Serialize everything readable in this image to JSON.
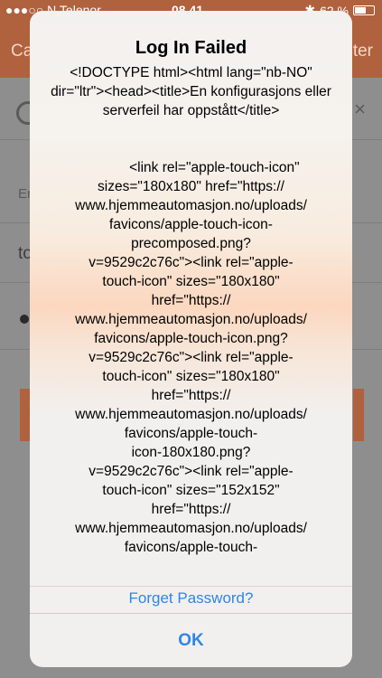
{
  "status_bar": {
    "carrier": "●●●○○ N Telenor",
    "time": "08.41",
    "bluetooth": "✱",
    "battery_percent": "62 %",
    "battery_level": 0.62
  },
  "nav": {
    "left_label": "Ca",
    "right_label": "ter"
  },
  "background": {
    "field_label": "Er",
    "username_prefix": "to",
    "close_glyph": "×"
  },
  "alert": {
    "title": "Log In Failed",
    "message": "<!DOCTYPE html><html lang=\"nb-NO\" dir=\"ltr\"><head><title>En konfigurasjons eller serverfeil har oppstått</title>\n\n\n            <link rel=\"apple-touch-icon\" sizes=\"180x180\" href=\"https://\nwww.hjemmeautomasjon.no/uploads/\nfavicons/apple-touch-icon-\nprecomposed.png?\nv=9529c2c76c\"><link rel=\"apple-\ntouch-icon\" sizes=\"180x180\"\nhref=\"https://\nwww.hjemmeautomasjon.no/uploads/\nfavicons/apple-touch-icon.png?\nv=9529c2c76c\"><link rel=\"apple-\ntouch-icon\" sizes=\"180x180\"\nhref=\"https://\nwww.hjemmeautomasjon.no/uploads/\nfavicons/apple-touch-\nicon-180x180.png?\nv=9529c2c76c\"><link rel=\"apple-\ntouch-icon\" sizes=\"152x152\"\nhref=\"https://\nwww.hjemmeautomasjon.no/uploads/\nfavicons/apple-touch-",
    "behind_link": "Forget Password?",
    "ok_label": "OK"
  }
}
